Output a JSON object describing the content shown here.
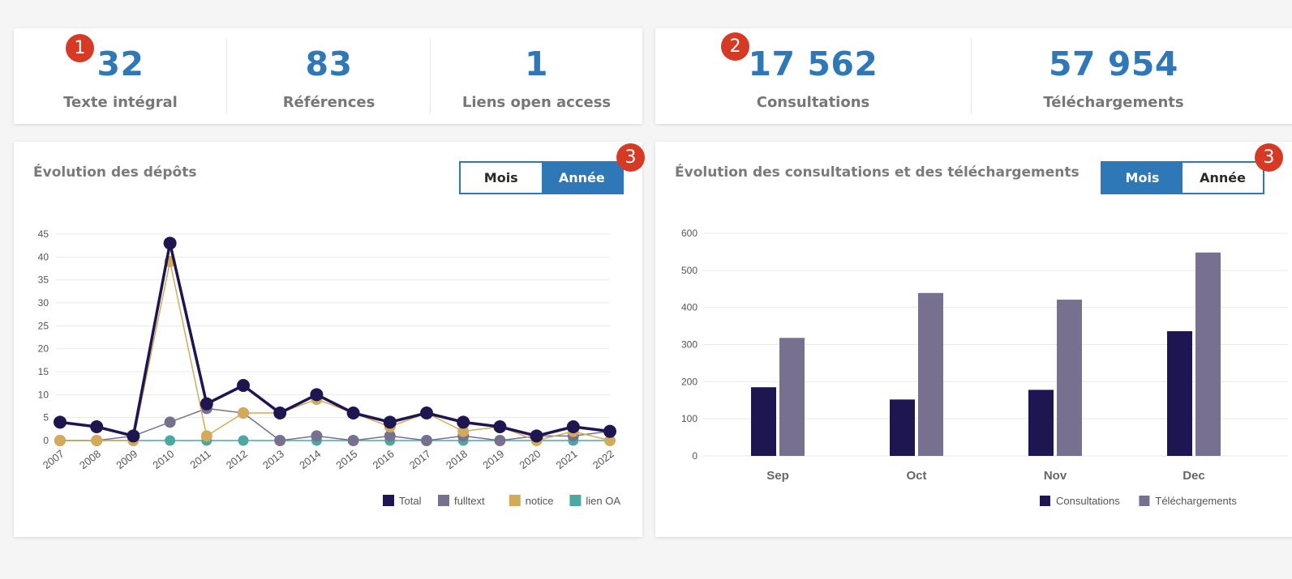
{
  "badges": {
    "b1": "1",
    "b2": "2",
    "b3": "3"
  },
  "deposits_stats": [
    {
      "value": "32",
      "label": "Texte intégral"
    },
    {
      "value": "83",
      "label": "Références"
    },
    {
      "value": "1",
      "label": "Liens open access"
    }
  ],
  "usage_stats": [
    {
      "value": "17 562",
      "label": "Consultations"
    },
    {
      "value": "57 954",
      "label": "Téléchargements"
    }
  ],
  "deposits_panel": {
    "title": "Évolution des dépôts",
    "toggle": {
      "month_label": "Mois",
      "year_label": "Année",
      "active": "year"
    }
  },
  "usage_panel": {
    "title": "Évolution des consultations et des téléchargements",
    "toggle": {
      "month_label": "Mois",
      "year_label": "Année",
      "active": "month"
    }
  },
  "colors": {
    "accent": "#2f78b7",
    "badge": "#d63a24",
    "total": "#1e1650",
    "fulltext": "#77718f",
    "notice": "#d2aa5a",
    "lien_oa": "#4aa9a0",
    "consultations": "#1e1650",
    "telechargements": "#77718f"
  },
  "chart_data": [
    {
      "type": "line",
      "title": "Évolution des dépôts",
      "x": [
        "2007",
        "2008",
        "2009",
        "2010",
        "2011",
        "2012",
        "2013",
        "2014",
        "2015",
        "2016",
        "2017",
        "2018",
        "2019",
        "2020",
        "2021",
        "2022"
      ],
      "ylim": [
        0,
        45
      ],
      "yticks": [
        0,
        5,
        10,
        15,
        20,
        25,
        30,
        35,
        40,
        45
      ],
      "grid": true,
      "legend": "bottom-right",
      "series": [
        {
          "name": "Total",
          "key": "total",
          "values": [
            4,
            3,
            1,
            43,
            8,
            12,
            6,
            10,
            6,
            4,
            6,
            4,
            3,
            1,
            3,
            2
          ]
        },
        {
          "name": "fulltext",
          "key": "fulltext",
          "values": [
            0,
            0,
            1,
            4,
            7,
            6,
            0,
            1,
            0,
            1,
            0,
            1,
            0,
            1,
            1,
            2
          ]
        },
        {
          "name": "notice",
          "key": "notice",
          "values": [
            0,
            0,
            0,
            39,
            1,
            6,
            6,
            9,
            6,
            3,
            6,
            2,
            3,
            0,
            2,
            0
          ]
        },
        {
          "name": "lien OA",
          "key": "lien_oa",
          "values": [
            0,
            0,
            0,
            0,
            0,
            0,
            0,
            0,
            0,
            0,
            0,
            0,
            0,
            0,
            0,
            0
          ]
        }
      ]
    },
    {
      "type": "bar",
      "title": "Évolution des consultations et des téléchargements",
      "categories": [
        "Sep",
        "Oct",
        "Nov",
        "Dec"
      ],
      "ylim": [
        0,
        600
      ],
      "yticks": [
        0,
        100,
        200,
        300,
        400,
        500,
        600
      ],
      "grid": true,
      "legend": "bottom-right",
      "series": [
        {
          "name": "Consultations",
          "key": "consultations",
          "values": [
            185,
            152,
            178,
            336
          ]
        },
        {
          "name": "Téléchargements",
          "key": "telechargements",
          "values": [
            318,
            439,
            421,
            548
          ]
        }
      ]
    }
  ]
}
